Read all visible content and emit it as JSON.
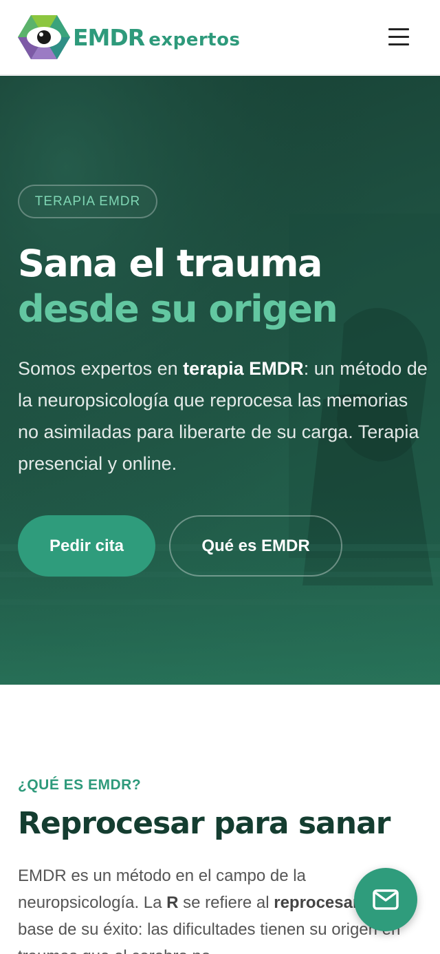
{
  "header": {
    "logo_word": "EMDR",
    "logo_suffix": "expertos",
    "menu_icon": "hamburger-icon"
  },
  "hero": {
    "badge": "TERAPIA EMDR",
    "title_line1": "Sana el trauma",
    "title_line2": "desde su origen",
    "desc_part1": "Somos expertos en ",
    "desc_bold": "terapia EMDR",
    "desc_part2": ": un método de la neuropsicología que reprocesa las memorias no asimiladas para liberarte de su carga. Terapia presencial y online.",
    "primary_button": "Pedir cita",
    "secondary_button": "Qué es EMDR"
  },
  "section": {
    "eyebrow": "¿QUÉ ES EMDR?",
    "title": "Reprocesar para sanar",
    "body_part1": "EMDR es un método en el campo de la neuropsicología. La ",
    "body_bold1": "R",
    "body_part2": " se refiere al ",
    "body_bold2": "reprocesamiento",
    "body_part3": ", base de su éxito: las dificultades tienen su origen en traumas que el cerebro no"
  },
  "fab": {
    "icon": "mail-icon"
  },
  "colors": {
    "brand_green": "#2e9a7b",
    "hero_bg": "#1f5343",
    "accent_light": "#63c7a1",
    "title_dark": "#143d30"
  }
}
